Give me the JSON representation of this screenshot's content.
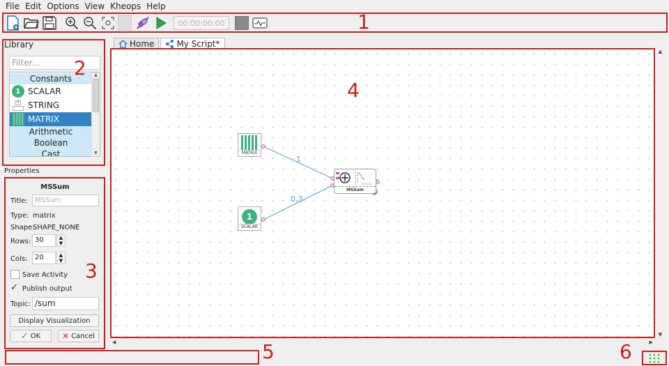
{
  "menu": [
    "File",
    "Edit",
    "Options",
    "View",
    "Kheops",
    "Help"
  ],
  "toolbar": {
    "timer": "00:00:00:00",
    "icons": [
      "new-file-icon",
      "open-folder-icon",
      "save-icon",
      "zoom-in-icon",
      "zoom-out-icon",
      "zoom-fit-icon",
      "grid-toggle-icon",
      "connect-icon",
      "play-icon",
      "stop-icon",
      "activity-icon"
    ]
  },
  "annotations": [
    "1",
    "2",
    "3",
    "4",
    "5",
    "6"
  ],
  "library": {
    "title": "Library",
    "filter_placeholder": "Filter...",
    "items": [
      {
        "label": "Constants",
        "kind": "category"
      },
      {
        "label": "SCALAR",
        "kind": "item",
        "icon_text": "1"
      },
      {
        "label": "STRING",
        "kind": "item",
        "icon_text": "A"
      },
      {
        "label": "MATRIX",
        "kind": "selected"
      },
      {
        "label": "Arithmetic",
        "kind": "category"
      },
      {
        "label": "Boolean",
        "kind": "category"
      },
      {
        "label": "Cast",
        "kind": "category"
      }
    ]
  },
  "properties": {
    "section_title": "Properties",
    "node_name": "MSSum",
    "title_label": "Title:",
    "title_placeholder": "MSSum",
    "type_label": "Type:",
    "type_value": "matrix",
    "shape_label": "Shape:",
    "shape_value": "SHAPE_NONE",
    "rows_label": "Rows:",
    "rows_value": "30",
    "cols_label": "Cols:",
    "cols_value": "20",
    "save_activity_label": "Save Activity",
    "save_activity_checked": false,
    "publish_output_label": "Publish output",
    "publish_output_checked": true,
    "topic_label": "Topic:",
    "topic_value": "/sum",
    "display_viz_label": "Display Visualization",
    "ok_label": "OK",
    "cancel_label": "Cancel"
  },
  "tabs": [
    {
      "label": "Home",
      "active": false
    },
    {
      "label": "My Script*",
      "active": true
    }
  ],
  "script": {
    "nodes": {
      "matrix": {
        "label": "MATRIX"
      },
      "scalar": {
        "label": "SCALAR",
        "icon_text": "1"
      },
      "mssum": {
        "label": "MSSum"
      }
    },
    "links": [
      {
        "from": "MATRIX",
        "to": "MSSum",
        "weight": "1"
      },
      {
        "from": "SCALAR",
        "to": "MSSum",
        "weight": "0,3"
      }
    ]
  },
  "colors": {
    "accent": "#3283c6",
    "annotation": "#c81e1e",
    "scalar_green": "#3cb27e",
    "link": "#4a9fd6",
    "play_green": "#29a846",
    "activity_green": "#2fc42f"
  }
}
